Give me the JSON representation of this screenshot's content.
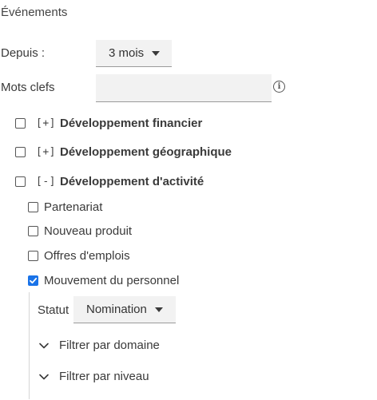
{
  "section_title": "Événements",
  "since": {
    "label": "Depuis :",
    "value": "3 mois"
  },
  "keywords": {
    "label": "Mots clefs",
    "value": "",
    "placeholder": ""
  },
  "categories": [
    {
      "expander": "[+]",
      "label": "Développement financier",
      "checked": false
    },
    {
      "expander": "[+]",
      "label": "Développement géographique",
      "checked": false
    },
    {
      "expander": "[-]",
      "label": "Développement d'activité",
      "checked": false
    }
  ],
  "subcategories": [
    {
      "label": "Partenariat",
      "checked": false
    },
    {
      "label": "Nouveau produit",
      "checked": false
    },
    {
      "label": "Offres d'emplois",
      "checked": false
    },
    {
      "label": "Mouvement du personnel",
      "checked": true
    }
  ],
  "status": {
    "label": "Statut",
    "value": "Nomination"
  },
  "filters": {
    "domain": "Filtrer par domaine",
    "level": "Filtrer par niveau"
  },
  "colors": {
    "accent": "#1a73e8",
    "field_bg": "#f2f2f2"
  },
  "icons": {
    "info": "info-icon",
    "check": "check-icon",
    "chevron": "chevron-down-icon",
    "caret": "caret-down-icon"
  }
}
